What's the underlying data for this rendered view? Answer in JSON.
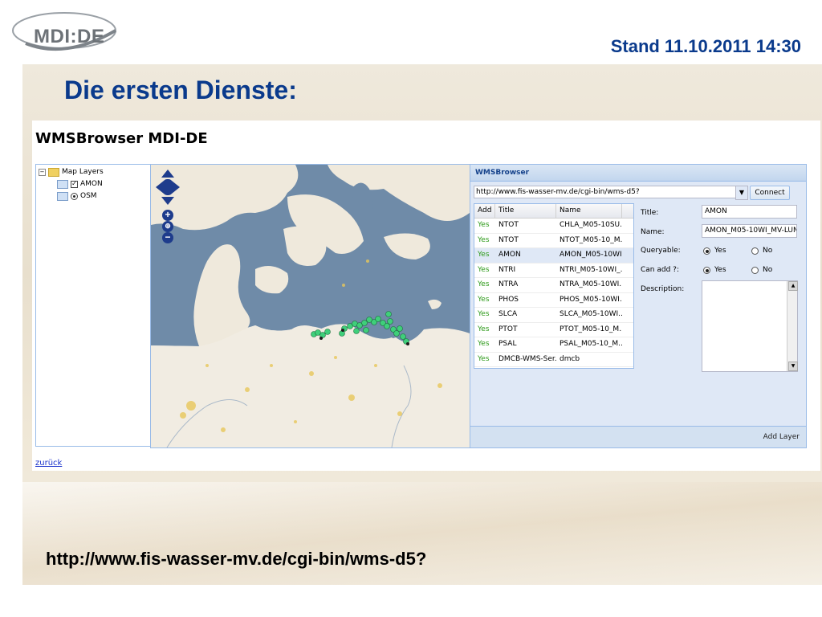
{
  "header": {
    "logo_text": "MDI:DE",
    "stand": "Stand 11.10.2011 14:30",
    "title": "Die ersten Dienste:"
  },
  "app": {
    "title": "WMSBrowser MDI-DE",
    "tree": {
      "root_label": "Map Layers",
      "items": [
        {
          "label": "AMON",
          "control": "checkbox",
          "checked": true
        },
        {
          "label": "OSM",
          "control": "radio",
          "checked": true
        }
      ]
    },
    "panel": {
      "header": "WMSBrowser",
      "url_value": "http://www.fis-wasser-mv.de/cgi-bin/wms-d5?",
      "connect_label": "Connect",
      "grid": {
        "columns": [
          "Add",
          "Title",
          "Name"
        ],
        "rows": [
          {
            "add": "Yes",
            "title": "NTOT",
            "name": "CHLA_M05-10SU..."
          },
          {
            "add": "Yes",
            "title": "NTOT",
            "name": "NTOT_M05-10_M..."
          },
          {
            "add": "Yes",
            "title": "AMON",
            "name": "AMON_M05-10WI..."
          },
          {
            "add": "Yes",
            "title": "NTRI",
            "name": "NTRI_M05-10WI_..."
          },
          {
            "add": "Yes",
            "title": "NTRA",
            "name": "NTRA_M05-10WI..."
          },
          {
            "add": "Yes",
            "title": "PHOS",
            "name": "PHOS_M05-10WI..."
          },
          {
            "add": "Yes",
            "title": "SLCA",
            "name": "SLCA_M05-10WI..."
          },
          {
            "add": "Yes",
            "title": "PTOT",
            "name": "PTOT_M05-10_M..."
          },
          {
            "add": "Yes",
            "title": "PSAL",
            "name": "PSAL_M05-10_M..."
          },
          {
            "add": "Yes",
            "title": "DMCB-WMS-Ser...",
            "name": "dmcb"
          }
        ]
      },
      "form": {
        "title_label": "Title:",
        "title_value": "AMON",
        "name_label": "Name:",
        "name_value": "AMON_M05-10WI_MV-LUN",
        "queryable_label": "Queryable:",
        "can_add_label": "Can add ?:",
        "yes": "Yes",
        "no": "No",
        "description_label": "Description:"
      },
      "footer_button": "Add Layer"
    },
    "back_link": "zurück"
  },
  "footer_url": "http://www.fis-wasser-mv.de/cgi-bin/wms-d5?",
  "colors": {
    "title_blue": "#0a3a8c",
    "water": "#6f8ba8",
    "land": "#f1ece2",
    "marker": "#3fcf7a"
  }
}
